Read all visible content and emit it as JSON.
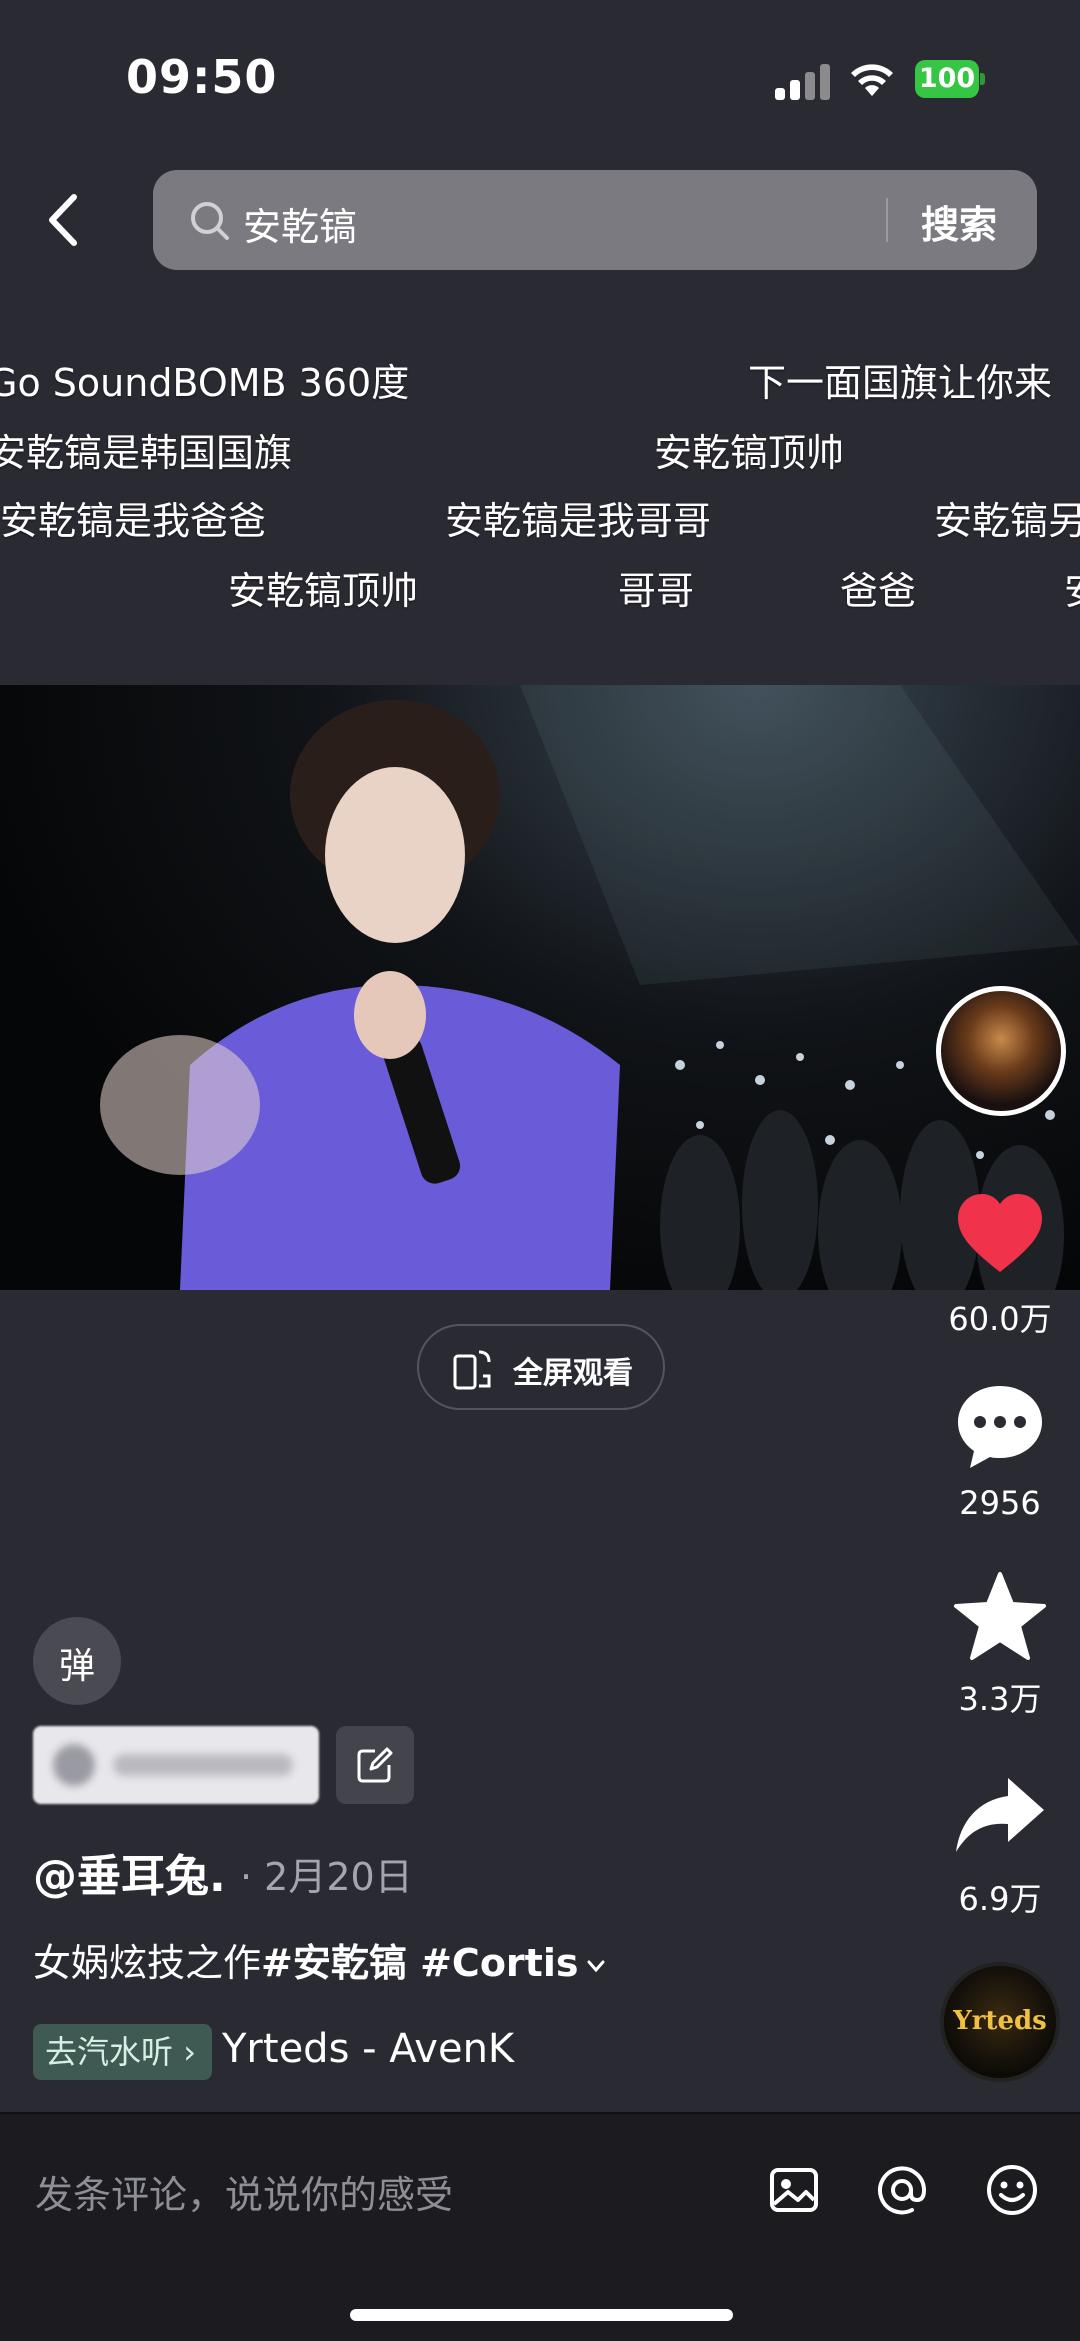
{
  "status_bar": {
    "time": "09:50",
    "battery": "100",
    "battery_color": "#35c743"
  },
  "search": {
    "query": "安乾镐",
    "button_label": "搜索",
    "icon": "search-icon"
  },
  "danmaku": [
    "Go SoundBOMB 360度",
    "下一面国旗让你来",
    "安乾镐是韩国国旗",
    "安乾镐顶帅",
    "安乾镐是我爸爸",
    "安乾镐是我哥哥",
    "安乾镐另",
    "安乾镐顶帅",
    "哥哥",
    "爸爸",
    "安"
  ],
  "player": {
    "fullscreen_label": "全屏观看"
  },
  "actions": {
    "like_count": "60.0万",
    "comment_count": "2956",
    "favorite_count": "3.3万",
    "share_count": "6.9万",
    "like_color": "#f0324a"
  },
  "music_disc_label": "Yrteds",
  "post": {
    "danmu_toggle": "弹",
    "author": "@垂耳兔.",
    "date": "· 2月20日",
    "caption_text": "女娲炫技之作",
    "caption_tags": "#安乾镐 #Cortis",
    "listen_label": "去汽水听",
    "song": "Yrteds - AvenK"
  },
  "comment_bar": {
    "placeholder": "发条评论，说说你的感受"
  }
}
